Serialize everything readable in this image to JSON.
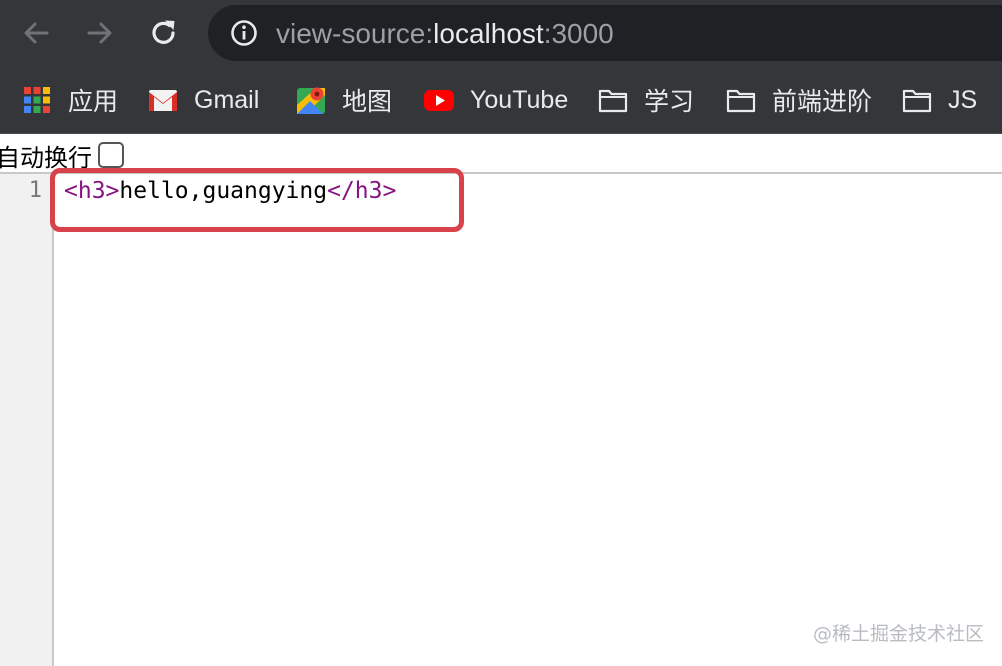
{
  "browser": {
    "url_scheme": "view-source:",
    "url_host": "localhost",
    "url_port": ":3000",
    "buttons": {
      "back": "back-arrow-icon",
      "forward": "forward-arrow-icon",
      "reload": "reload-icon",
      "site_info": "info-icon"
    }
  },
  "bookmarks": [
    {
      "label": "应用",
      "icon": "apps-grid-icon"
    },
    {
      "label": "Gmail",
      "icon": "gmail-icon"
    },
    {
      "label": "地图",
      "icon": "maps-icon"
    },
    {
      "label": "YouTube",
      "icon": "youtube-icon"
    },
    {
      "label": "学习",
      "icon": "folder-icon"
    },
    {
      "label": "前端进阶",
      "icon": "folder-icon"
    },
    {
      "label": "JS",
      "icon": "folder-icon"
    }
  ],
  "view_source": {
    "wrap_label": "自动换行",
    "wrap_checked": false,
    "lines": [
      {
        "number": "1",
        "open_tag": "<h3>",
        "text": "hello,guangying",
        "close_tag": "</h3>"
      }
    ]
  },
  "watermark": "@稀土掘金技术社区",
  "colors": {
    "toolbar_bg": "#35363a",
    "omnibox_bg": "#202124",
    "tag_color": "#881280",
    "highlight_border": "#d8434b"
  }
}
